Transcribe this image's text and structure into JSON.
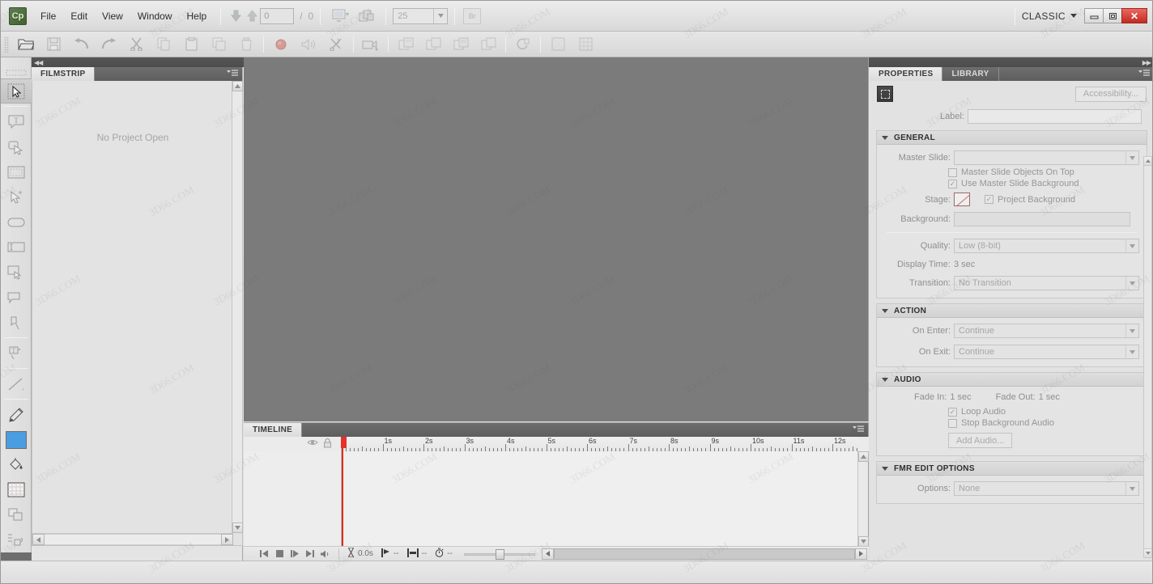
{
  "app": {
    "name": "Adobe Captivate",
    "logo_text": "Cp",
    "workspace": "CLASSIC",
    "workspace_caret": "▼"
  },
  "menubar": {
    "items": [
      "File",
      "Edit",
      "View",
      "Window",
      "Help"
    ],
    "nav": {
      "prev_icon": "arrow-down-icon",
      "next_icon": "arrow-up-icon"
    },
    "slide_field_value": "0",
    "slide_separator": "/",
    "slide_total": "0",
    "preview_icon": "preview-icon",
    "publish_icon": "publish-icon",
    "zoom_value": "25",
    "zoom_caret": "▼",
    "bridge_label": "Br",
    "window_buttons": {
      "minimize": "minimize-icon",
      "restore": "restore-icon",
      "close": "✕"
    }
  },
  "toolbar": {
    "buttons": [
      {
        "name": "open-button",
        "icon": "folder-icon"
      },
      {
        "name": "save-button",
        "icon": "floppy-disk-icon"
      },
      {
        "name": "undo-button",
        "icon": "undo-arrow-icon"
      },
      {
        "name": "redo-button",
        "icon": "redo-arrow-icon"
      },
      {
        "name": "cut-button",
        "icon": "scissors-icon"
      },
      {
        "name": "copy-button",
        "icon": "copy-icon"
      },
      {
        "name": "paste-button",
        "icon": "clipboard-icon"
      },
      {
        "name": "duplicate-button",
        "icon": "duplicate-icon"
      },
      {
        "name": "delete-button",
        "icon": "trash-icon"
      },
      {
        "name": "record-button",
        "icon": "record-dot-icon"
      },
      {
        "name": "record-audio-button",
        "icon": "speaker-icon"
      },
      {
        "name": "edit-audio-button",
        "icon": "audio-edit-icon"
      },
      {
        "name": "slide-video-button",
        "icon": "slide-video-icon"
      },
      {
        "name": "insert-blank-slide-button",
        "icon": "slide-add-icon"
      },
      {
        "name": "insert-image-slide-button",
        "icon": "slide-image-icon"
      },
      {
        "name": "insert-ppt-slide-button",
        "icon": "slide-ppt-icon"
      },
      {
        "name": "insert-question-slide-button",
        "icon": "slide-question-icon"
      },
      {
        "name": "rollover-button",
        "icon": "rollover-icon"
      },
      {
        "name": "preview-project-button",
        "icon": "preview-project-icon"
      },
      {
        "name": "publish-button",
        "icon": "publish-grid-icon"
      }
    ]
  },
  "tools_panel": {
    "collapse_icon": "collapse-right-icon",
    "tools": [
      {
        "name": "select-tool",
        "icon": "arrow-select-icon",
        "selected": true
      },
      {
        "name": "text-caption-tool",
        "icon": "text-caption-icon"
      },
      {
        "name": "click-box-tool",
        "icon": "click-box-icon"
      },
      {
        "name": "highlight-box-tool",
        "icon": "highlight-box-icon"
      },
      {
        "name": "mouse-tool",
        "icon": "mouse-pointer-icon"
      },
      {
        "name": "rounded-rect-tool",
        "icon": "rounded-rectangle-icon"
      },
      {
        "name": "text-entry-box-tool",
        "icon": "text-entry-box-icon"
      },
      {
        "name": "rollover-caption-tool",
        "icon": "rollover-caption-icon"
      },
      {
        "name": "rollover-area-tool",
        "icon": "rollover-area-icon"
      },
      {
        "name": "zoom-area-tool",
        "icon": "zoom-area-icon"
      },
      {
        "name": "typing-tool",
        "icon": "typing-icon"
      },
      {
        "name": "line-tool",
        "icon": "line-icon"
      },
      {
        "name": "pencil-tool",
        "icon": "pencil-icon"
      },
      {
        "name": "fill-color-swatch",
        "icon": "color-swatch",
        "color": "#4a9de0"
      },
      {
        "name": "paint-bucket-tool",
        "icon": "paint-bucket-icon"
      },
      {
        "name": "grid-swatch-tool",
        "icon": "grid-swatch-icon"
      },
      {
        "name": "arrange-tool",
        "icon": "arrange-icon"
      },
      {
        "name": "align-tool",
        "icon": "align-icon"
      }
    ]
  },
  "filmstrip": {
    "tab_label": "FILMSTRIP",
    "panel_menu_icon": "panel-menu-icon",
    "empty_message": "No Project Open"
  },
  "stage": {
    "background_color": "#7b7b7b"
  },
  "timeline": {
    "tab_label": "TIMELINE",
    "panel_menu_icon": "panel-menu-icon",
    "eye_icon": "eye-icon",
    "lock_icon": "lock-icon",
    "ruler_labels": [
      "1s",
      "2s",
      "3s",
      "4s",
      "5s",
      "6s",
      "7s",
      "8s",
      "9s",
      "10s",
      "11s",
      "12s"
    ],
    "playhead_position_s": 0,
    "controls": [
      {
        "name": "go-to-start-button",
        "icon": "skip-back-icon"
      },
      {
        "name": "stop-button",
        "icon": "stop-icon"
      },
      {
        "name": "play-button",
        "icon": "play-icon"
      },
      {
        "name": "go-to-end-button",
        "icon": "skip-forward-icon"
      },
      {
        "name": "mute-button",
        "icon": "speaker-mute-icon"
      }
    ],
    "status": {
      "elapsed_icon": "hourglass-icon",
      "elapsed_value": "0.0s",
      "selected_start_icon": "start-marker-icon",
      "selected_start_value": "--",
      "selected_duration_icon": "duration-marker-icon",
      "selected_duration_value": "--",
      "slide_duration_icon": "stopwatch-icon",
      "slide_duration_value": "--"
    },
    "zoom_slider_value": 50
  },
  "properties": {
    "tabs": [
      {
        "label": "PROPERTIES",
        "active": true
      },
      {
        "label": "LIBRARY",
        "active": false
      }
    ],
    "panel_menu_icon": "panel-menu-icon",
    "thumbnail_icon": "slide-thumbnail-icon",
    "accessibility_button": "Accessibility...",
    "label_field": {
      "label": "Label:",
      "value": "",
      "placeholder": ""
    },
    "sections": [
      {
        "id": "general",
        "title": "GENERAL",
        "expanded": true,
        "fields": [
          {
            "type": "select",
            "label": "Master Slide:",
            "value": ""
          },
          {
            "type": "checkbox",
            "label": "Master Slide Objects On Top",
            "checked": false
          },
          {
            "type": "checkbox",
            "label": "Use Master Slide Background",
            "checked": true
          },
          {
            "type": "stage",
            "label": "Stage:",
            "checkbox_label": "Project Background",
            "checked": true
          },
          {
            "type": "input",
            "label": "Background:",
            "value": ""
          },
          {
            "type": "select",
            "label": "Quality:",
            "value": "Low (8-bit)"
          },
          {
            "type": "text",
            "label": "Display Time:",
            "value": "3 sec"
          },
          {
            "type": "select",
            "label": "Transition:",
            "value": "No Transition"
          }
        ]
      },
      {
        "id": "action",
        "title": "ACTION",
        "expanded": true,
        "fields": [
          {
            "type": "select",
            "label": "On Enter:",
            "value": "Continue"
          },
          {
            "type": "select",
            "label": "On Exit:",
            "value": "Continue"
          }
        ]
      },
      {
        "id": "audio",
        "title": "AUDIO",
        "expanded": true,
        "fields": [
          {
            "type": "text",
            "label": "Fade In:",
            "value": "1 sec"
          },
          {
            "type": "text",
            "label": "Fade Out:",
            "value": "1 sec"
          },
          {
            "type": "checkbox",
            "label": "Loop Audio",
            "checked": true
          },
          {
            "type": "checkbox",
            "label": "Stop Background Audio",
            "checked": false
          },
          {
            "type": "button",
            "label": "Add Audio..."
          }
        ]
      },
      {
        "id": "fmr",
        "title": "FMR EDIT OPTIONS",
        "expanded": true,
        "fields": [
          {
            "type": "select",
            "label": "Options:",
            "value": "None"
          }
        ]
      }
    ]
  },
  "colors": {
    "stage_gray": "#7b7b7b",
    "chrome_gray": "#e2e2e2",
    "panel_tab_dark": "#5e5e5e",
    "playhead_red": "#e02b20",
    "accent_blue": "#4a9de0",
    "close_red": "#c32a22",
    "logo_green": "#41612f"
  },
  "watermark": {
    "texts": [
      "3D66.COM",
      "3D66.COM",
      "3D66.COM",
      "3D66.COM",
      "3D66.COM",
      "3D66.COM"
    ]
  }
}
